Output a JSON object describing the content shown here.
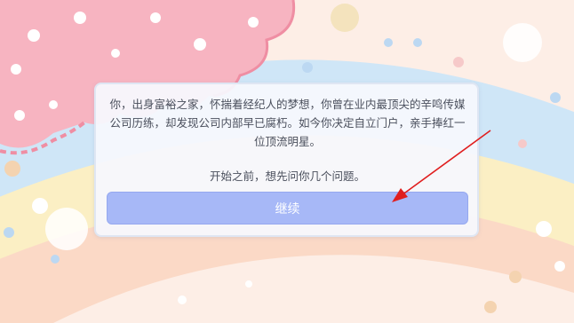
{
  "dialog": {
    "story": "你，出身富裕之家，怀揣着经纪人的梦想，你曾在业内最顶尖的辛鸣传媒公司历练，却发现公司内部早已腐朽。如今你决定自立门户，亲手捧红一位顶流明星。",
    "question": "开始之前，想先问你几个问题。",
    "continue_label": "继续"
  },
  "colors": {
    "button": "#a7b8f7",
    "annotation_arrow": "#e01e1e",
    "cloud_pink": "#f7b4c1"
  }
}
